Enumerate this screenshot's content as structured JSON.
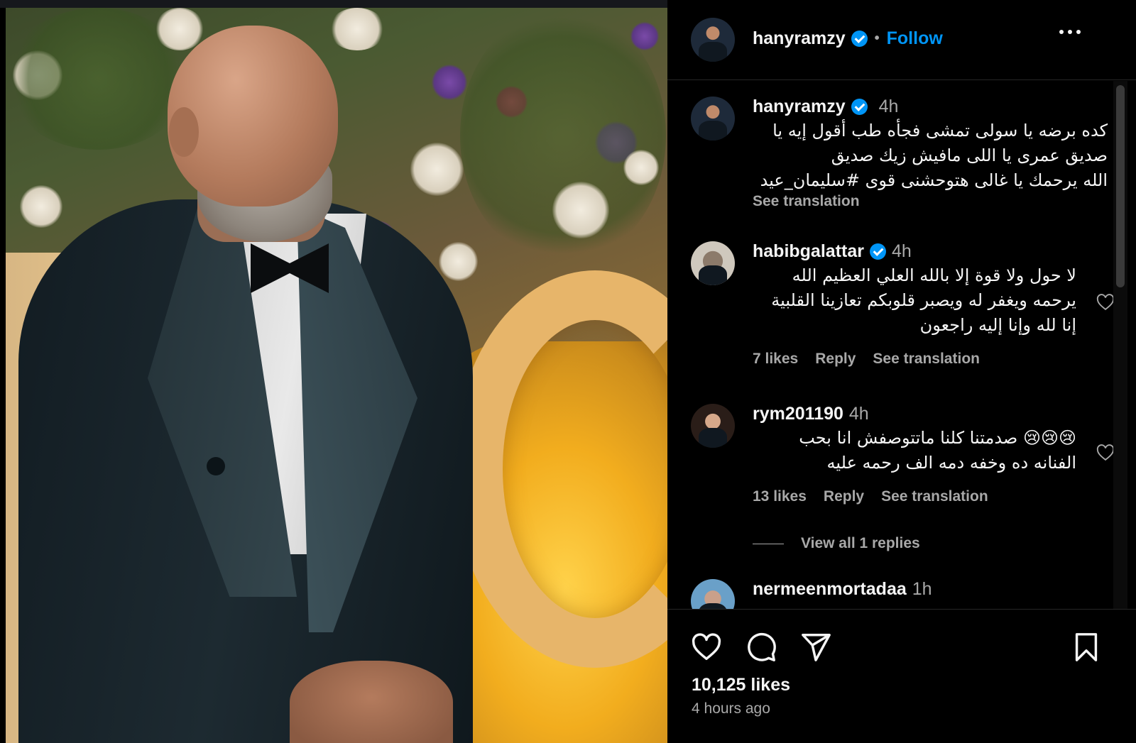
{
  "post": {
    "author": "hanyramzy",
    "follow_label": "Follow",
    "separator": "•"
  },
  "caption": {
    "username": "hanyramzy",
    "time": "4h",
    "text_lines": [
      "كده برضه يا سولى تمشى فجأه طب أقول إيه يا",
      "صديق عمرى يا اللى مافيش زيك صديق",
      "الله يرحمك يا غالى هتوحشنى قوى #سليمان_عيد"
    ],
    "see_translation": "See translation"
  },
  "comments": [
    {
      "username": "habibgalattar",
      "verified": true,
      "time": "4h",
      "text_lines": [
        "لا حول ولا قوة إلا بالله العلي العظيم الله",
        "يرحمه ويغفر له ويصبر قلوبكم تعازينا القلبية",
        "إنا لله وإنا إليه راجعون"
      ],
      "likes": "7 likes",
      "reply": "Reply",
      "see_translation": "See translation"
    },
    {
      "username": "rym201190",
      "verified": false,
      "time": "4h",
      "text_lines": [
        "😢😢😢 صدمتنا كلنا ماتتوصفش انا بحب",
        "الفنانه ده وخفه دمه الف رحمه عليه"
      ],
      "likes": "13 likes",
      "reply": "Reply",
      "see_translation": "See translation"
    },
    {
      "username": "nermeenmortadaa",
      "verified": false,
      "time": "1h"
    }
  ],
  "view_replies": "View all 1 replies",
  "footer": {
    "likes": "10,125 likes",
    "posted": "4 hours ago"
  },
  "icons": {
    "like": "heart-icon",
    "comment": "comment-bubble-icon",
    "share": "paper-plane-icon",
    "save": "bookmark-icon",
    "more": "more-dots-icon",
    "verified": "verified-badge-icon"
  },
  "colors": {
    "accent": "#0095f6",
    "background": "#000000",
    "secondary_text": "#a8a8a8"
  }
}
